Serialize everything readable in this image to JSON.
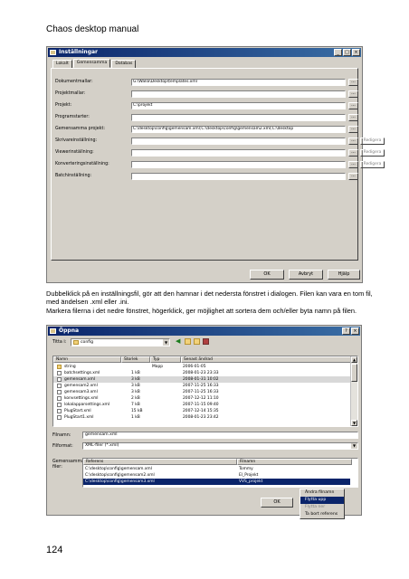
{
  "doc": {
    "header": "Chaos desktop manual",
    "paragraph1": "Dubbelklick på en inställningsfil, gör att den hamnar i det nedersta fönstret i dialogen. Filen kan vara en tom fil, med ändelsen .xml eller .ini.",
    "paragraph2": "Markera filerna i det nedre fönstret, högerklick, ger möjlighet att sortera dem och/eller byta namn på filen.",
    "page_number": "124"
  },
  "settings_dialog": {
    "title": "Inställningar",
    "window_buttons": [
      "_",
      "□",
      "×"
    ],
    "tabs": [
      "Lokalt",
      "Gemensamma",
      "Databas"
    ],
    "active_tab": "Gemensamma",
    "fields": [
      {
        "label": "Dokumentmallar:",
        "value": "G:\\Walla\\Desktop\\templates.xml",
        "has_edit": false
      },
      {
        "label": "Projektmallar:",
        "value": "",
        "has_edit": false
      },
      {
        "label": "Projekt:",
        "value": "C:\\projekt",
        "has_edit": false
      },
      {
        "label": "Programstarter:",
        "value": "",
        "has_edit": false
      },
      {
        "label": "Gemensamma projekt:",
        "value": "C:\\desktop\\config\\gemensam.xml;C:\\desktop\\config\\gemensam2.xml;C:\\desktop",
        "has_edit": false
      },
      {
        "label": "Skrivareinställning:",
        "value": "",
        "has_edit": true
      },
      {
        "label": "Viewerinställning:",
        "value": "",
        "has_edit": true
      },
      {
        "label": "Konverteringsinställning:",
        "value": "",
        "has_edit": true
      },
      {
        "label": "Batchinställning:",
        "value": "",
        "has_edit": false
      }
    ],
    "browse_label": "...",
    "edit_label": "Redigera",
    "ok_label": "OK",
    "cancel_label": "Avbryt",
    "help_label": "Hjälp"
  },
  "open_dialog": {
    "title": "Öppna",
    "window_buttons": [
      "?",
      "×"
    ],
    "look_in_label": "Titta i:",
    "look_in_value": "config",
    "columns": [
      "Namn",
      "Storlek",
      "Typ",
      "Senast ändrad"
    ],
    "files": [
      {
        "name": "string",
        "size": "",
        "type": "Mapp",
        "modified": "2006-01-05",
        "folder": true
      },
      {
        "name": "batchsettings.xml",
        "size": "1 kB",
        "type": "",
        "modified": "2008-01-23 23:33",
        "folder": false
      },
      {
        "name": "gemensam.xml",
        "size": "3 kB",
        "type": "",
        "modified": "2008-01-31 10:02",
        "folder": false
      },
      {
        "name": "gemensam2.xml",
        "size": "3 kB",
        "type": "",
        "modified": "2007-11-25 16:33",
        "folder": false
      },
      {
        "name": "gemensam3.xml",
        "size": "3 kB",
        "type": "",
        "modified": "2007-11-25 16:33",
        "folder": false
      },
      {
        "name": "konvsettings.xml",
        "size": "2 kB",
        "type": "",
        "modified": "2007-12-12 11:10",
        "folder": false
      },
      {
        "name": "lokalapparsettings.xml",
        "size": "7 kB",
        "type": "",
        "modified": "2007-11-15 09:40",
        "folder": false
      },
      {
        "name": "PlugStart.xml",
        "size": "15 kB",
        "type": "",
        "modified": "2007-12-14 15:35",
        "folder": false
      },
      {
        "name": "PlugStart1.xml",
        "size": "1 kB",
        "type": "",
        "modified": "2008-01-23 23:42",
        "folder": false
      }
    ],
    "filename_label": "Filnamn:",
    "filename_value": "gemensam.xml",
    "filetype_label": "Filformat:",
    "filetype_value": "XML-filer (*.xml)",
    "shared_label": "Gemensamma filer:",
    "shared_columns": [
      "Referens",
      "Filnamn"
    ],
    "shared_files": [
      {
        "ref": "C:\\desktop\\config\\gemensam.xml",
        "name": "Tommy"
      },
      {
        "ref": "C:\\desktop\\config\\gemensam2.xml",
        "name": "El_Projekt"
      },
      {
        "ref": "C:\\desktop\\config\\gemensam3.xml",
        "name": "VVS_projekt"
      }
    ],
    "ok_label": "OK",
    "context_menu": [
      "Ändra filnamn",
      "Flytta upp",
      "Flytta ner",
      "Ta bort referens"
    ]
  }
}
